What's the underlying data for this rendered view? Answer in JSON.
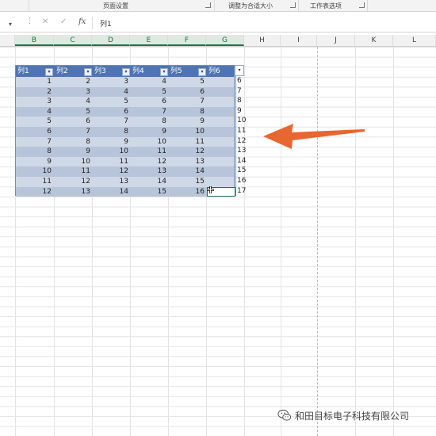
{
  "ribbon": {
    "groups": [
      "页面设置",
      "调整为合适大小",
      "工作表选项"
    ]
  },
  "formula_bar": {
    "name_dropdown_icon": "chevron-down-icon",
    "more_icon": "vertical-ellipsis-icon",
    "cancel_icon": "close-icon",
    "confirm_icon": "check-icon",
    "fx_label": "fx",
    "content": "列1"
  },
  "columns": [
    "B",
    "C",
    "D",
    "E",
    "F",
    "G",
    "H",
    "I",
    "J",
    "K",
    "L"
  ],
  "selected_columns": [
    "B",
    "C",
    "D",
    "E",
    "F",
    "G"
  ],
  "table": {
    "headers": [
      "列1",
      "列2",
      "列3",
      "列4",
      "列5",
      "列6"
    ],
    "header_color": "#4f74b1",
    "band_colors": [
      "#cfd8e6",
      "#b7c4da"
    ],
    "rows": [
      [
        1,
        2,
        3,
        4,
        5
      ],
      [
        2,
        3,
        4,
        5,
        6
      ],
      [
        3,
        4,
        5,
        6,
        7
      ],
      [
        4,
        5,
        6,
        7,
        8
      ],
      [
        5,
        6,
        7,
        8,
        9
      ],
      [
        6,
        7,
        8,
        9,
        10
      ],
      [
        7,
        8,
        9,
        10,
        11
      ],
      [
        8,
        9,
        10,
        11,
        12
      ],
      [
        9,
        10,
        11,
        12,
        13
      ],
      [
        10,
        11,
        12,
        13,
        14
      ],
      [
        11,
        12,
        13,
        14,
        15
      ],
      [
        12,
        13,
        14,
        15,
        16
      ]
    ],
    "overflow_column": [
      "6",
      "7",
      "8",
      "9",
      "10",
      "11",
      "12",
      "13",
      "14",
      "15",
      "16",
      "17"
    ]
  },
  "annotation": {
    "arrow_color": "#e8662f"
  },
  "watermark": {
    "icon": "wechat-icon",
    "text": "和田目标电子科技有限公司"
  }
}
